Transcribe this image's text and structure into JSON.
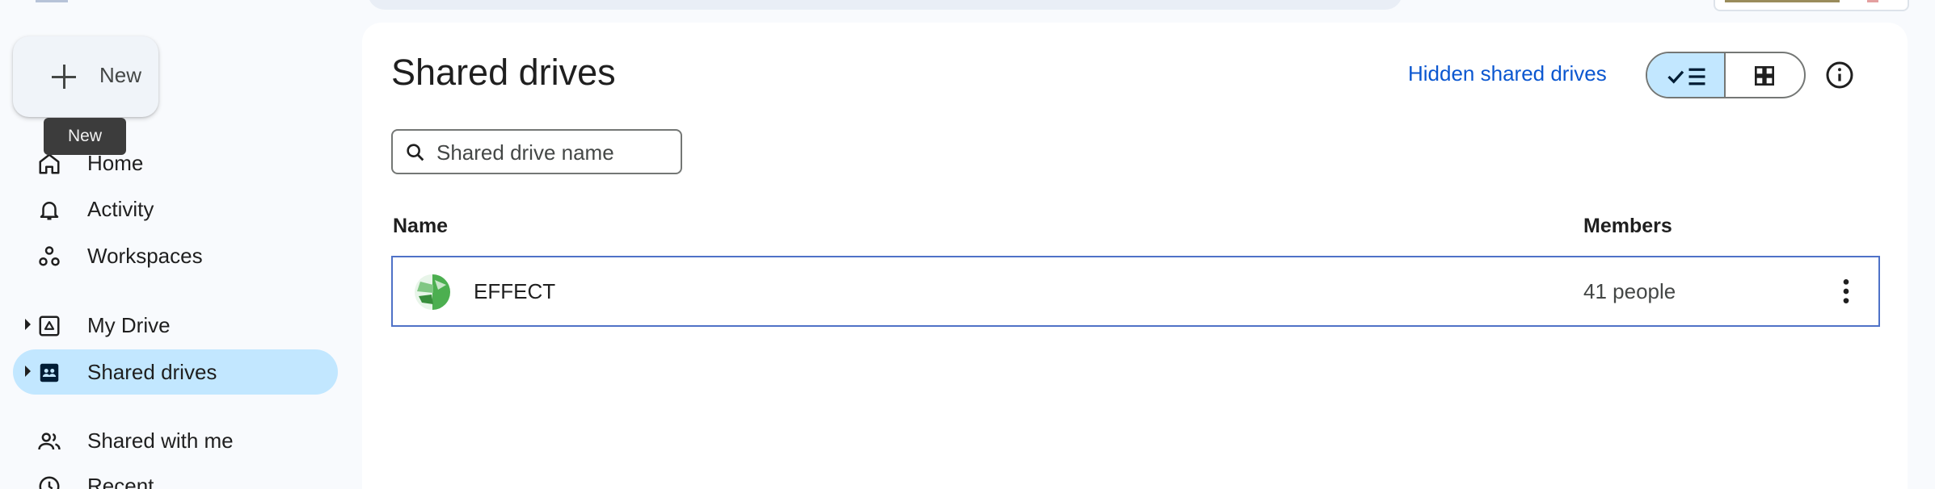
{
  "new_button": {
    "label": "New",
    "tooltip": "New"
  },
  "sidebar": {
    "items": [
      {
        "label": "Home",
        "icon": "home-icon"
      },
      {
        "label": "Activity",
        "icon": "bell-icon"
      },
      {
        "label": "Workspaces",
        "icon": "workspaces-icon"
      },
      {
        "label": "My Drive",
        "icon": "my-drive-icon"
      },
      {
        "label": "Shared drives",
        "icon": "shared-drives-icon",
        "active": true
      },
      {
        "label": "Shared with me",
        "icon": "people-icon"
      },
      {
        "label": "Recent",
        "icon": "clock-icon"
      }
    ]
  },
  "main": {
    "title": "Shared drives",
    "hidden_link": "Hidden shared drives",
    "search_placeholder": "Shared drive name",
    "columns": {
      "name": "Name",
      "members": "Members"
    },
    "drives": [
      {
        "name": "EFFECT",
        "members": "41 people"
      }
    ]
  },
  "colors": {
    "accent": "#0b57d0",
    "active_bg": "#c2e7ff",
    "page_bg": "#f8fafd",
    "row_border": "#4f72c7"
  }
}
